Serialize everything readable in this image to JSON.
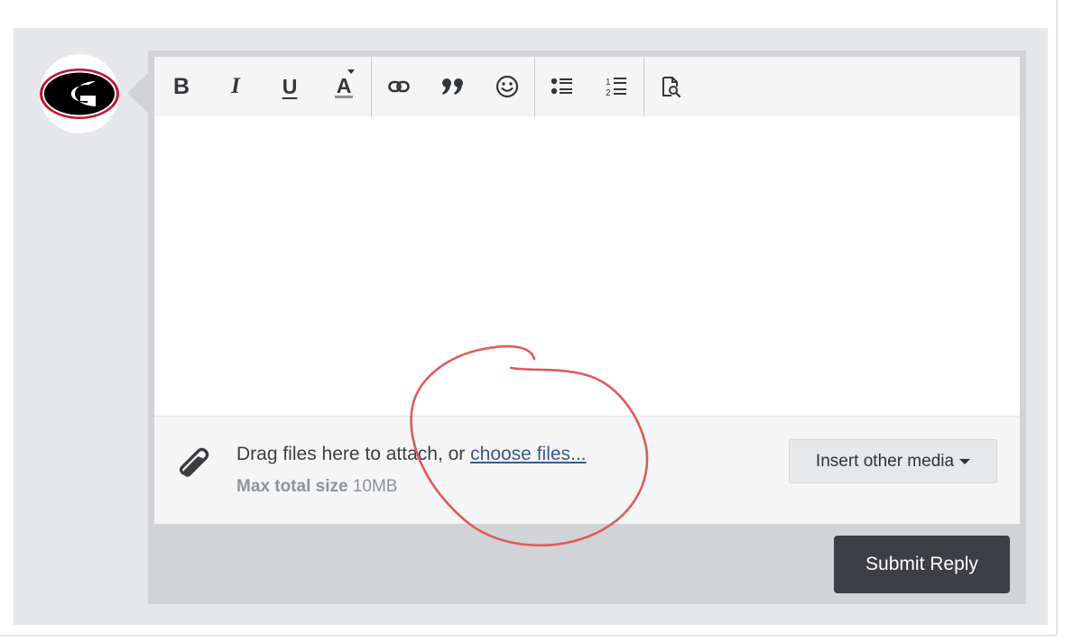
{
  "avatar": {
    "alt": "Georgia G logo",
    "letter": "G",
    "colors": {
      "ring": "#c8102e",
      "fill": "#000000",
      "letter": "#ffffff"
    }
  },
  "toolbar": {
    "groups": [
      [
        "bold-icon",
        "italic-icon",
        "underline-icon",
        "text-color-icon"
      ],
      [
        "link-icon",
        "quote-icon",
        "smiley-icon"
      ],
      [
        "bullet-list-icon",
        "numbered-list-icon"
      ],
      [
        "preview-icon"
      ]
    ],
    "bold_label": "B",
    "italic_label": "I",
    "underline_label": "U",
    "color_label": "A"
  },
  "attachments": {
    "prefix": "Drag files here to attach, or ",
    "link": "choose files...",
    "max_label": "Max total size",
    "max_value": "10MB",
    "insert_media_label": "Insert other media"
  },
  "submit_label": "Submit Reply",
  "colors": {
    "annotation": "#e05a5c",
    "link": "#3b5a8c",
    "submit_bg": "#3d3f44"
  }
}
